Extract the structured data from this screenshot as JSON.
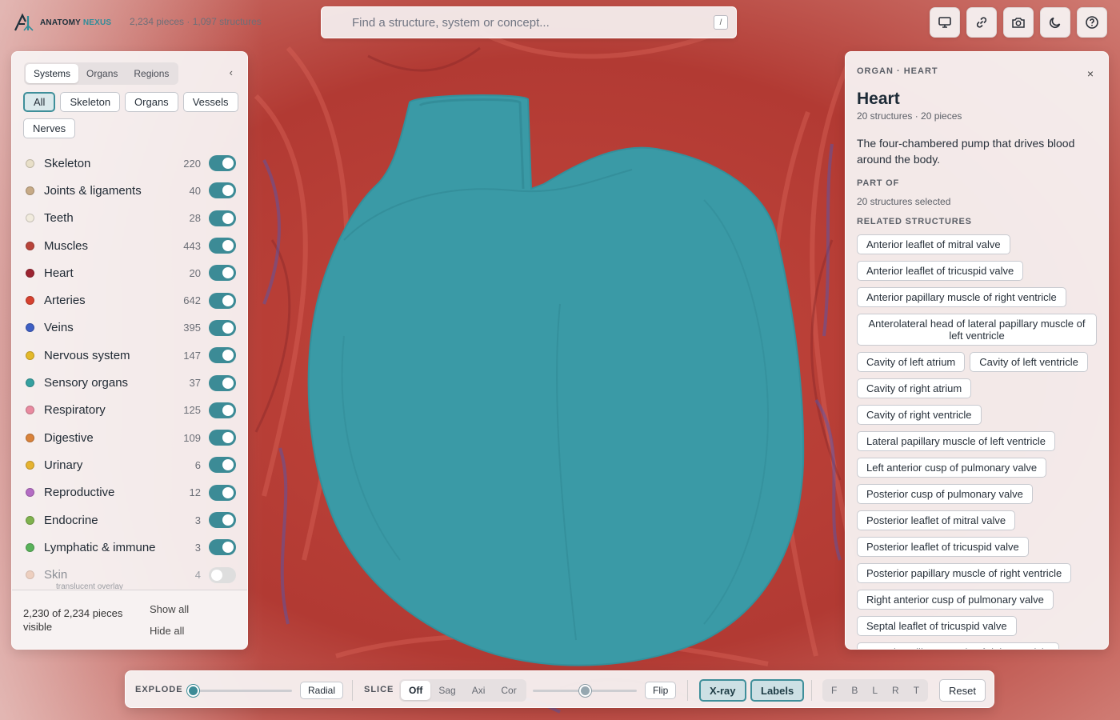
{
  "brand": {
    "name_main": "ANATOMY",
    "name_accent": "NEXUS"
  },
  "stats": "2,234 pieces · 1,097 structures",
  "search": {
    "placeholder": "Find a structure, system or concept...",
    "shortcut": "/"
  },
  "top_actions": [
    {
      "name": "monitor",
      "icon": "monitor-icon"
    },
    {
      "name": "link",
      "icon": "link-icon"
    },
    {
      "name": "camera",
      "icon": "camera-icon"
    },
    {
      "name": "theme",
      "icon": "moon-icon"
    },
    {
      "name": "help",
      "icon": "help-icon"
    }
  ],
  "left_panel": {
    "tabs": [
      {
        "label": "Systems",
        "active": true
      },
      {
        "label": "Organs",
        "active": false
      },
      {
        "label": "Regions",
        "active": false
      }
    ],
    "collapse": "‹",
    "filters": [
      {
        "label": "All",
        "active": true
      },
      {
        "label": "Skeleton",
        "active": false
      },
      {
        "label": "Organs",
        "active": false
      },
      {
        "label": "Vessels",
        "active": false
      },
      {
        "label": "Nerves",
        "active": false
      }
    ],
    "systems": [
      {
        "label": "Skeleton",
        "count": "220",
        "color": "#e8dfc8",
        "on": true
      },
      {
        "label": "Joints & ligaments",
        "count": "40",
        "color": "#c7aa86",
        "on": true
      },
      {
        "label": "Teeth",
        "count": "28",
        "color": "#f1ebdd",
        "on": true
      },
      {
        "label": "Muscles",
        "count": "443",
        "color": "#b8443a",
        "on": true
      },
      {
        "label": "Heart",
        "count": "20",
        "color": "#9c2431",
        "on": true
      },
      {
        "label": "Arteries",
        "count": "642",
        "color": "#d6412f",
        "on": true
      },
      {
        "label": "Veins",
        "count": "395",
        "color": "#3f5fc4",
        "on": true
      },
      {
        "label": "Nervous system",
        "count": "147",
        "color": "#e4b92a",
        "on": true
      },
      {
        "label": "Sensory organs",
        "count": "37",
        "color": "#35a0a0",
        "on": true
      },
      {
        "label": "Respiratory",
        "count": "125",
        "color": "#e98aa0",
        "on": true
      },
      {
        "label": "Digestive",
        "count": "109",
        "color": "#d9823a",
        "on": true
      },
      {
        "label": "Urinary",
        "count": "6",
        "color": "#e6b330",
        "on": true
      },
      {
        "label": "Reproductive",
        "count": "12",
        "color": "#b46cc4",
        "on": true
      },
      {
        "label": "Endocrine",
        "count": "3",
        "color": "#7fb24e",
        "on": true
      },
      {
        "label": "Lymphatic & immune",
        "count": "3",
        "color": "#59b25a",
        "on": true
      },
      {
        "label": "Skin",
        "count": "4",
        "color": "#e9bba0",
        "on": false
      }
    ],
    "skin_note": "translucent overlay",
    "visible_text": "2,230 of 2,234 pieces visible",
    "show_all": "Show all",
    "hide_all": "Hide all"
  },
  "right_panel": {
    "kicker": "ORGAN · HEART",
    "close": "×",
    "title": "Heart",
    "subtitle": "20 structures · 20 pieces",
    "description": "The four-chambered pump that drives blood around the body.",
    "part_of_heading": "PART OF",
    "part_of_text": "20 structures selected",
    "related_heading": "RELATED STRUCTURES",
    "related": [
      "Anterior leaflet of mitral valve",
      "Anterior leaflet of tricuspid valve",
      "Anterior papillary muscle of right ventricle",
      "Anterolateral head of lateral papillary muscle of left ventricle",
      "Cavity of left atrium",
      "Cavity of left ventricle",
      "Cavity of right atrium",
      "Cavity of right ventricle",
      "Lateral papillary muscle of left ventricle",
      "Left anterior cusp of pulmonary valve",
      "Posterior cusp of pulmonary valve",
      "Posterior leaflet of mitral valve",
      "Posterior leaflet of tricuspid valve",
      "Posterior papillary muscle of right ventricle",
      "Right anterior cusp of pulmonary valve",
      "Septal leaflet of tricuspid valve",
      "Septal papillary muscle of right ventricle"
    ]
  },
  "toolbar": {
    "explode_label": "EXPLODE",
    "explode_value": 0,
    "radial": "Radial",
    "slice_label": "SLICE",
    "slice_modes": [
      {
        "label": "Off",
        "active": true
      },
      {
        "label": "Sag",
        "active": false
      },
      {
        "label": "Axi",
        "active": false
      },
      {
        "label": "Cor",
        "active": false
      }
    ],
    "slice_position": 0.5,
    "flip": "Flip",
    "xray": "X-ray",
    "labels": "Labels",
    "views": [
      "F",
      "B",
      "L",
      "R",
      "T"
    ],
    "reset": "Reset"
  },
  "colors": {
    "accent": "#3c8b96",
    "heart": "#3a9aa6"
  }
}
